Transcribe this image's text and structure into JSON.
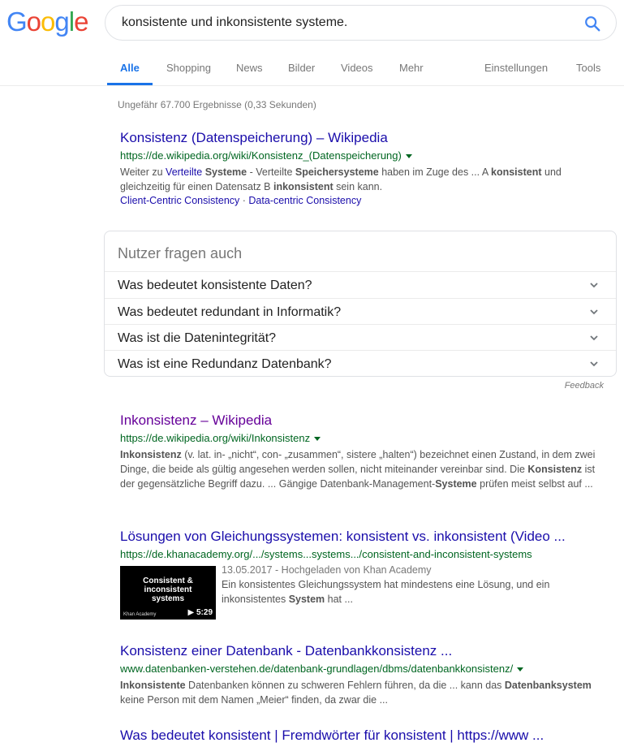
{
  "logo": {
    "letters": [
      "G",
      "o",
      "o",
      "g",
      "l",
      "e"
    ],
    "colors": [
      "#4285F4",
      "#EA4335",
      "#FBBC05",
      "#4285F4",
      "#34A853",
      "#EA4335"
    ]
  },
  "search": {
    "query": "konsistente und inkonsistente systeme."
  },
  "tabs": {
    "all": "Alle",
    "shopping": "Shopping",
    "news": "News",
    "images": "Bilder",
    "videos": "Videos",
    "more": "Mehr",
    "settings": "Einstellungen",
    "tools": "Tools"
  },
  "stats": "Ungefähr 67.700 Ergebnisse (0,33 Sekunden)",
  "results": [
    {
      "title": "Konsistenz (Datenspeicherung) – Wikipedia",
      "url": "https://de.wikipedia.org/wiki/Konsistenz_(Datenspeicherung)",
      "sitelinks": [
        "Client-Centric Consistency",
        "Data-centric Consistency"
      ]
    },
    {
      "title": "Inkonsistenz – Wikipedia",
      "url": "https://de.wikipedia.org/wiki/Inkonsistenz"
    },
    {
      "title": "Lösungen von Gleichungssystemen: konsistent vs. inkonsistent (Video ...",
      "url": "https://de.khanacademy.org/.../systems...systems.../consistent-and-inconsistent-systems",
      "date": "13.05.2017 - Hochgeladen von Khan Academy",
      "thumb_title_1": "Consistent &",
      "thumb_title_2": "inconsistent",
      "thumb_title_3": "systems",
      "thumb_brand": "Khan Academy",
      "thumb_duration": "▶ 5:29"
    },
    {
      "title": "Konsistenz einer Datenbank - Datenbankkonsistenz ...",
      "url": "www.datenbanken-verstehen.de/datenbank-grundlagen/dbms/datenbankkonsistenz/"
    },
    {
      "title": "Was bedeutet konsistent | Fremdwörter für konsistent | https://www ..."
    }
  ],
  "paa": {
    "title": "Nutzer fragen auch",
    "questions": [
      "Was bedeutet konsistente Daten?",
      "Was bedeutet redundant in Informatik?",
      "Was ist die Datenintegrität?",
      "Was ist eine Redundanz Datenbank?"
    ],
    "feedback": "Feedback"
  }
}
